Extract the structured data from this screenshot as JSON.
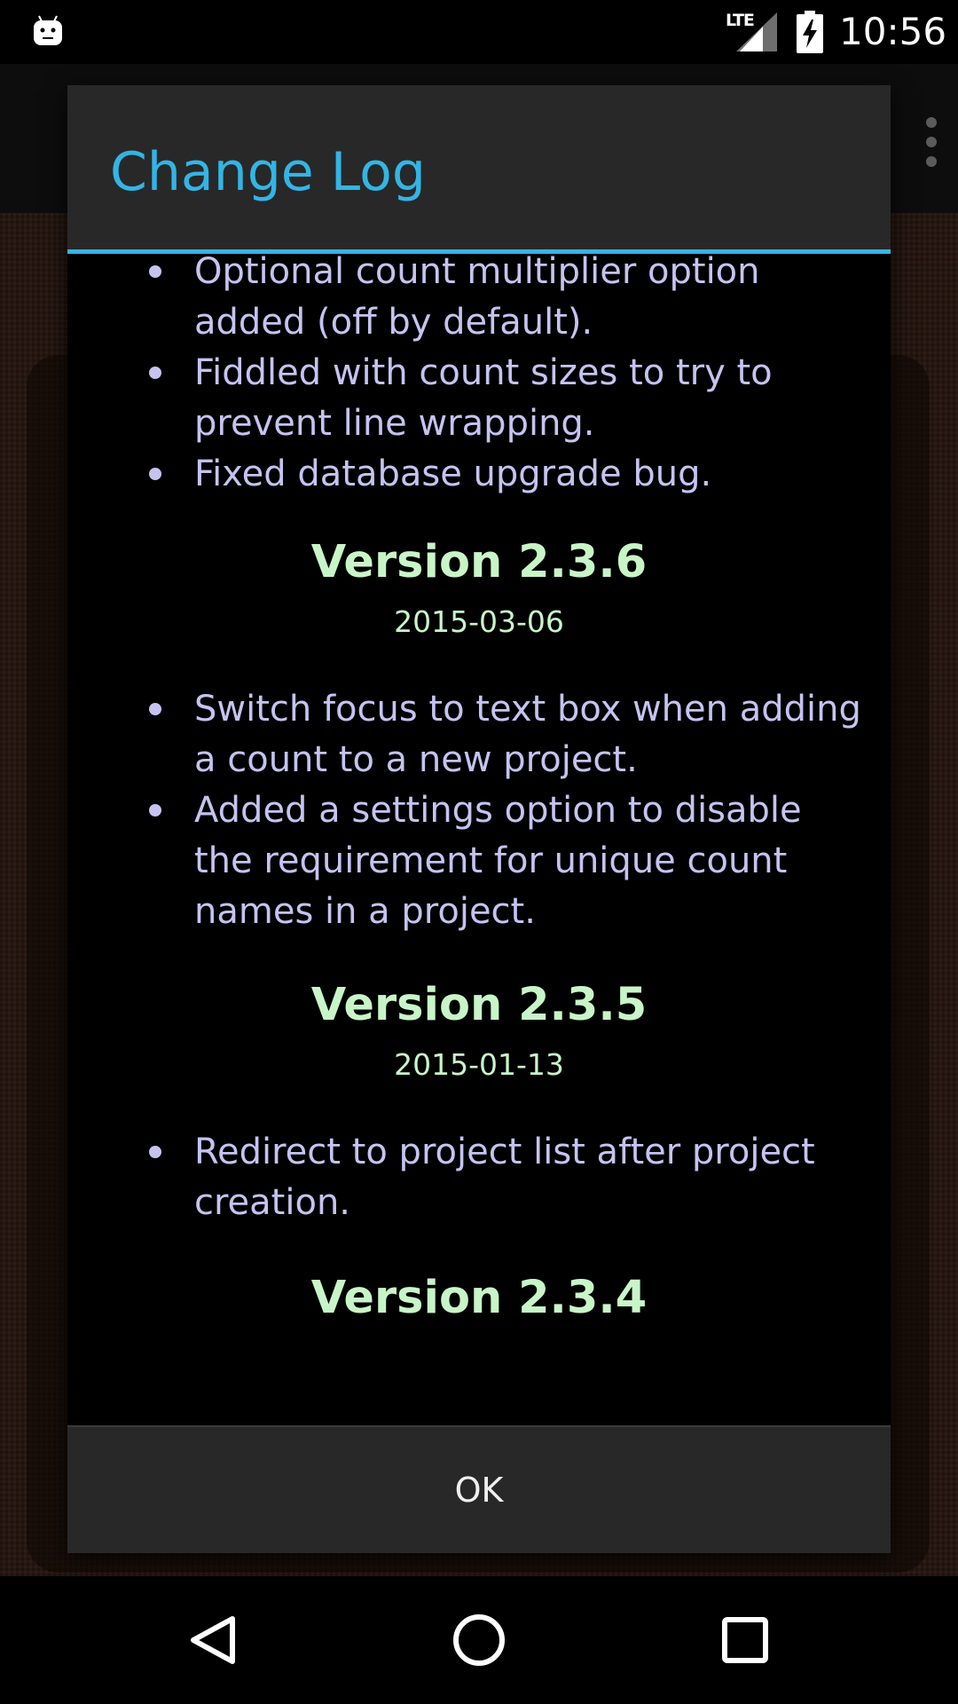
{
  "status_bar": {
    "network": "LTE",
    "time": "10:56"
  },
  "dialog": {
    "title": "Change Log",
    "ok_label": "OK",
    "entries_top": [
      "Optional count multiplier option added (off by default).",
      "Fiddled with count sizes to try to prevent line wrapping.",
      "Fixed database upgrade bug."
    ],
    "versions": [
      {
        "version": "Version 2.3.6",
        "date": "2015-03-06",
        "items": [
          "Switch focus to text box when adding a count to a new project.",
          "Added a settings option to disable the requirement for unique count names in a project."
        ]
      },
      {
        "version": "Version 2.3.5",
        "date": "2015-01-13",
        "items": [
          "Redirect to project list after project creation."
        ]
      },
      {
        "version": "Version 2.3.4"
      }
    ]
  },
  "colors": {
    "accent": "#33b5e5",
    "bullet_text": "#c5c3f0",
    "version_text": "#c8f5c8"
  },
  "icons": {
    "status_left": "android-notification-icon",
    "signal": "signal-icon",
    "battery": "battery-charging-icon",
    "overflow": "overflow-menu-icon",
    "nav_back": "back-icon",
    "nav_home": "home-icon",
    "nav_recents": "recents-icon"
  }
}
